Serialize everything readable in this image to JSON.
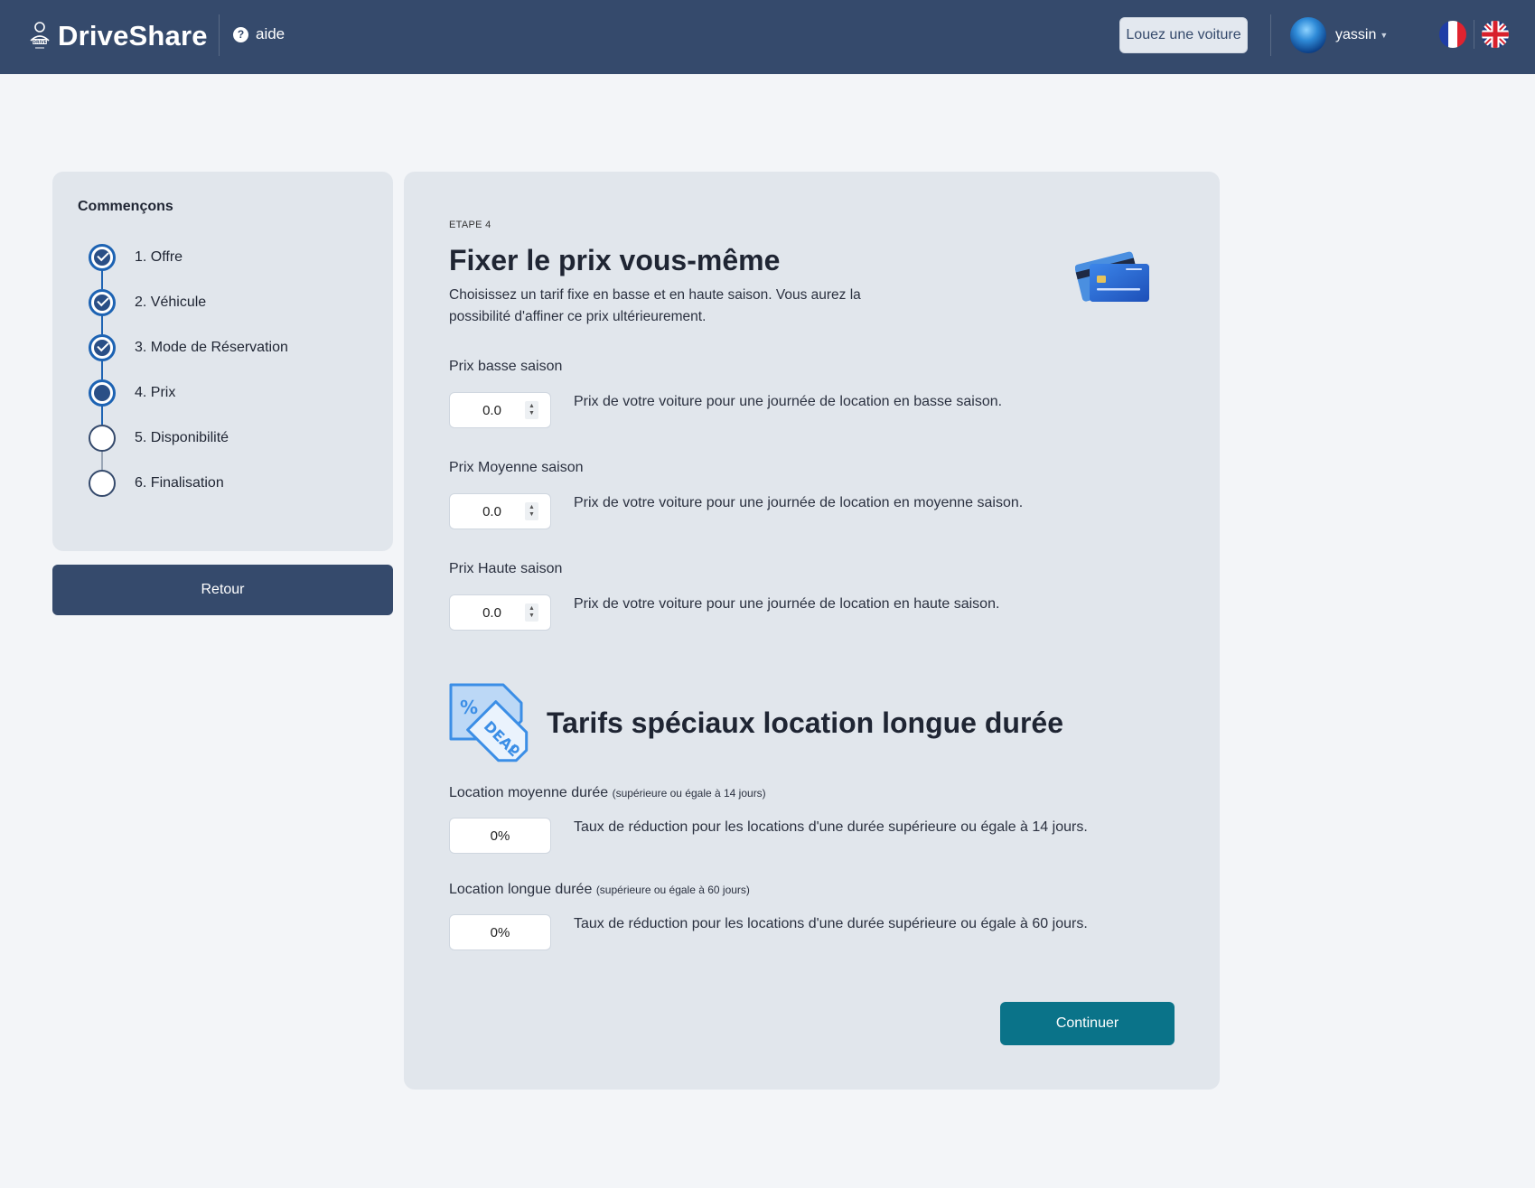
{
  "header": {
    "brand": "DriveShare",
    "help_label": "aide",
    "rent_button": "Louez une voiture",
    "username": "yassin",
    "languages": [
      "fr",
      "en"
    ]
  },
  "sidebar": {
    "title": "Commençons",
    "steps": [
      {
        "label": "1. Offre",
        "status": "done"
      },
      {
        "label": "2. Véhicule",
        "status": "done"
      },
      {
        "label": "3. Mode de Réservation",
        "status": "done"
      },
      {
        "label": "4. Prix",
        "status": "current"
      },
      {
        "label": "5. Disponibilité",
        "status": "todo"
      },
      {
        "label": "6. Finalisation",
        "status": "todo"
      }
    ],
    "back_button": "Retour"
  },
  "main": {
    "step_tag": "ETAPE 4",
    "title": "Fixer le prix vous-même",
    "description": "Choisissez un tarif fixe en basse et en haute saison. Vous aurez la possibilité d'affiner ce prix ultérieurement.",
    "prices": [
      {
        "label": "Prix basse saison",
        "value": "0.0",
        "help": "Prix de votre voiture pour une journée de location en basse saison."
      },
      {
        "label": "Prix Moyenne saison",
        "value": "0.0",
        "help": "Prix de votre voiture pour une journée de location en moyenne saison."
      },
      {
        "label": "Prix Haute saison",
        "value": "0.0",
        "help": "Prix de votre voiture pour une journée de location en haute saison."
      }
    ],
    "special_title": "Tarifs spéciaux location longue durée",
    "discounts": [
      {
        "label": "Location moyenne durée",
        "note": "(supérieure ou égale à 14 jours)",
        "value": "0%",
        "help": "Taux de réduction pour les locations d'une durée supérieure ou égale à 14 jours."
      },
      {
        "label": "Location longue durée",
        "note": "(supérieure ou égale à 60 jours)",
        "value": "0%",
        "help": "Taux de réduction pour les locations d'une durée supérieure ou égale à 60 jours."
      }
    ],
    "continue_button": "Continuer"
  },
  "colors": {
    "header_bg": "#354a6c",
    "card_bg": "#e1e6ec",
    "step_active": "#1d63b3",
    "continue_bg": "#0a7389"
  }
}
